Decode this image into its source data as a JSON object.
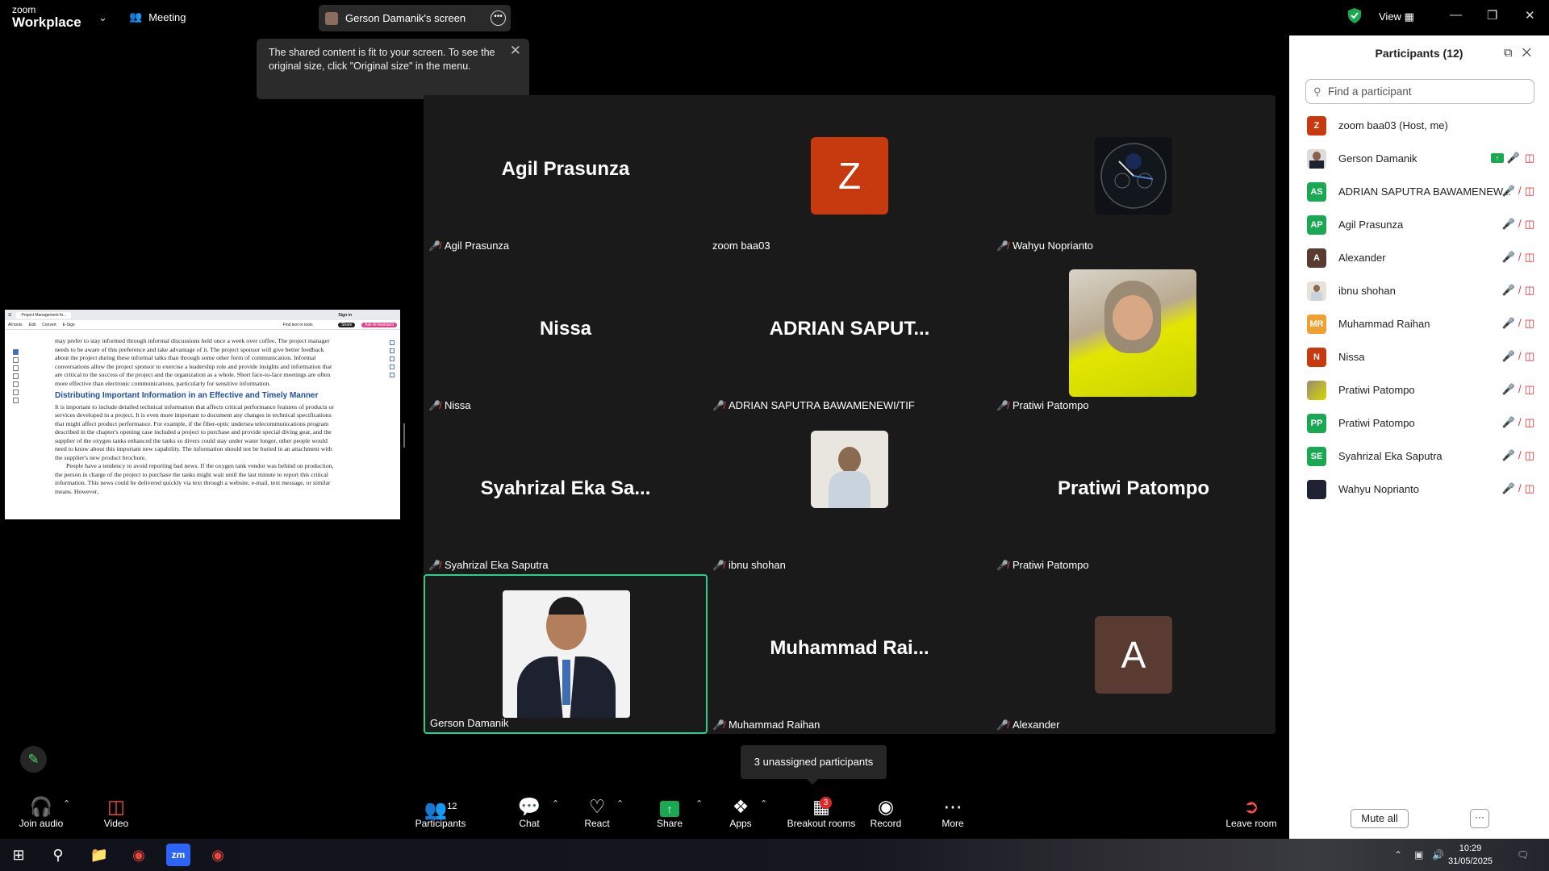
{
  "titlebar": {
    "logo_top": "zoom",
    "logo_bottom": "Workplace",
    "meeting_label": "Meeting",
    "share_label": "Gerson Damanik's screen",
    "view_label": "View"
  },
  "tooltip": {
    "text": "The shared content is fit to your screen. To see the original size, click \"Original size\" in the menu."
  },
  "shared_screen": {
    "tab_label": "Project Management fo...",
    "sign_in": "Sign in",
    "toolbar": [
      "All tools",
      "Edit",
      "Convert",
      "E-Sign"
    ],
    "find_text": "Find text or tools",
    "share_btn": "Share",
    "ai_btn": "Ask AI Assistant",
    "para1": "may prefer to stay informed through informal discussions held once a week over coffee. The project manager needs to be aware of this preference and take advantage of it. The project sponsor will give better feedback about the project during these informal talks than through some other form of communication. Informal conversations allow the project sponsor to exercise a leadership role and provide insights and information that are critical to the success of the project and the organization as a whole. Short face-to-face meetings are often more effective than electronic communications, particularly for sensitive information.",
    "heading": "Distributing Important Information in an Effective and Timely Manner",
    "para2": "It is important to include detailed technical information that affects critical performance features of products or services developed in a project. It is even more important to document any changes in technical specifications that might affect product performance. For example, if the fiber-optic undersea telecommunications program described in the chapter's opening case included a project to purchase and provide special diving gear, and the supplier of the oxygen tanks enhanced the tanks so divers could stay under water longer, other people would need to know about this important new capability. The information should not be buried in an attachment with the supplier's new product brochure.",
    "para3": "People have a tendency to avoid reporting bad news. If the oxygen tank vendor was behind on production, the person in charge of the project to purchase the tanks might wait until the last minute to report this critical information. This news could be delivered quickly via text through a website, e-mail, text message, or similar means. However,"
  },
  "gallery": {
    "tiles": [
      {
        "label": "Agil Prasunza",
        "display": "Agil Prasunza",
        "muted": true
      },
      {
        "label": "zoom baa03",
        "display": "Z",
        "muted": false,
        "color": "#c7390f"
      },
      {
        "label": "Wahyu Noprianto",
        "display": "",
        "muted": true
      },
      {
        "label": "Nissa",
        "display": "Nissa",
        "muted": true
      },
      {
        "label": "ADRIAN SAPUTRA BAWAMENEWI/TIF",
        "display": "ADRIAN SAPUT...",
        "muted": true
      },
      {
        "label": "Pratiwi Patompo",
        "display": "",
        "muted": true
      },
      {
        "label": "Syahrizal Eka Saputra",
        "display": "Syahrizal Eka Sa...",
        "muted": true
      },
      {
        "label": "ibnu shohan",
        "display": "",
        "muted": true
      },
      {
        "label": "Pratiwi Patompo",
        "display": "Pratiwi Patompo",
        "muted": true
      },
      {
        "label": "Gerson Damanik",
        "display": "",
        "muted": false
      },
      {
        "label": "Muhammad Raihan",
        "display": "Muhammad Rai...",
        "muted": true
      },
      {
        "label": "Alexander",
        "display": "A",
        "muted": true,
        "color": "#5a3b31"
      }
    ]
  },
  "unassigned": "3 unassigned participants",
  "toolbar": {
    "join_audio": "Join audio",
    "video": "Video",
    "participants": "Participants",
    "participants_count": "12",
    "chat": "Chat",
    "react": "React",
    "share": "Share",
    "apps": "Apps",
    "breakout": "Breakout rooms",
    "breakout_badge": "3",
    "record": "Record",
    "more": "More",
    "leave": "Leave room"
  },
  "panel": {
    "title": "Participants (12)",
    "search_placeholder": "Find a participant",
    "participants": [
      {
        "initials": "Z",
        "name": "zoom baa03 (Host, me)",
        "color": "#c7390f"
      },
      {
        "initials": "",
        "name": "Gerson Damanik",
        "color": "#dcdcdc"
      },
      {
        "initials": "AS",
        "name": "ADRIAN SAPUTRA BAWAMENEW...",
        "color": "#1aa853"
      },
      {
        "initials": "AP",
        "name": "Agil Prasunza",
        "color": "#1aa853"
      },
      {
        "initials": "A",
        "name": "Alexander",
        "color": "#5a3b31"
      },
      {
        "initials": "",
        "name": "ibnu shohan",
        "color": "#dcdcdc"
      },
      {
        "initials": "MR",
        "name": "Muhammad Raihan",
        "color": "#f0a030"
      },
      {
        "initials": "N",
        "name": "Nissa",
        "color": "#c7390f"
      },
      {
        "initials": "",
        "name": "Pratiwi Patompo",
        "color": "#c9c020"
      },
      {
        "initials": "PP",
        "name": "Pratiwi Patompo",
        "color": "#1aa853"
      },
      {
        "initials": "SE",
        "name": "Syahrizal Eka Saputra",
        "color": "#1aa853"
      },
      {
        "initials": "",
        "name": "Wahyu Noprianto",
        "color": "#1e2233"
      }
    ],
    "mute_all": "Mute all"
  },
  "taskbar": {
    "time": "10:29",
    "date": "31/05/2025"
  }
}
